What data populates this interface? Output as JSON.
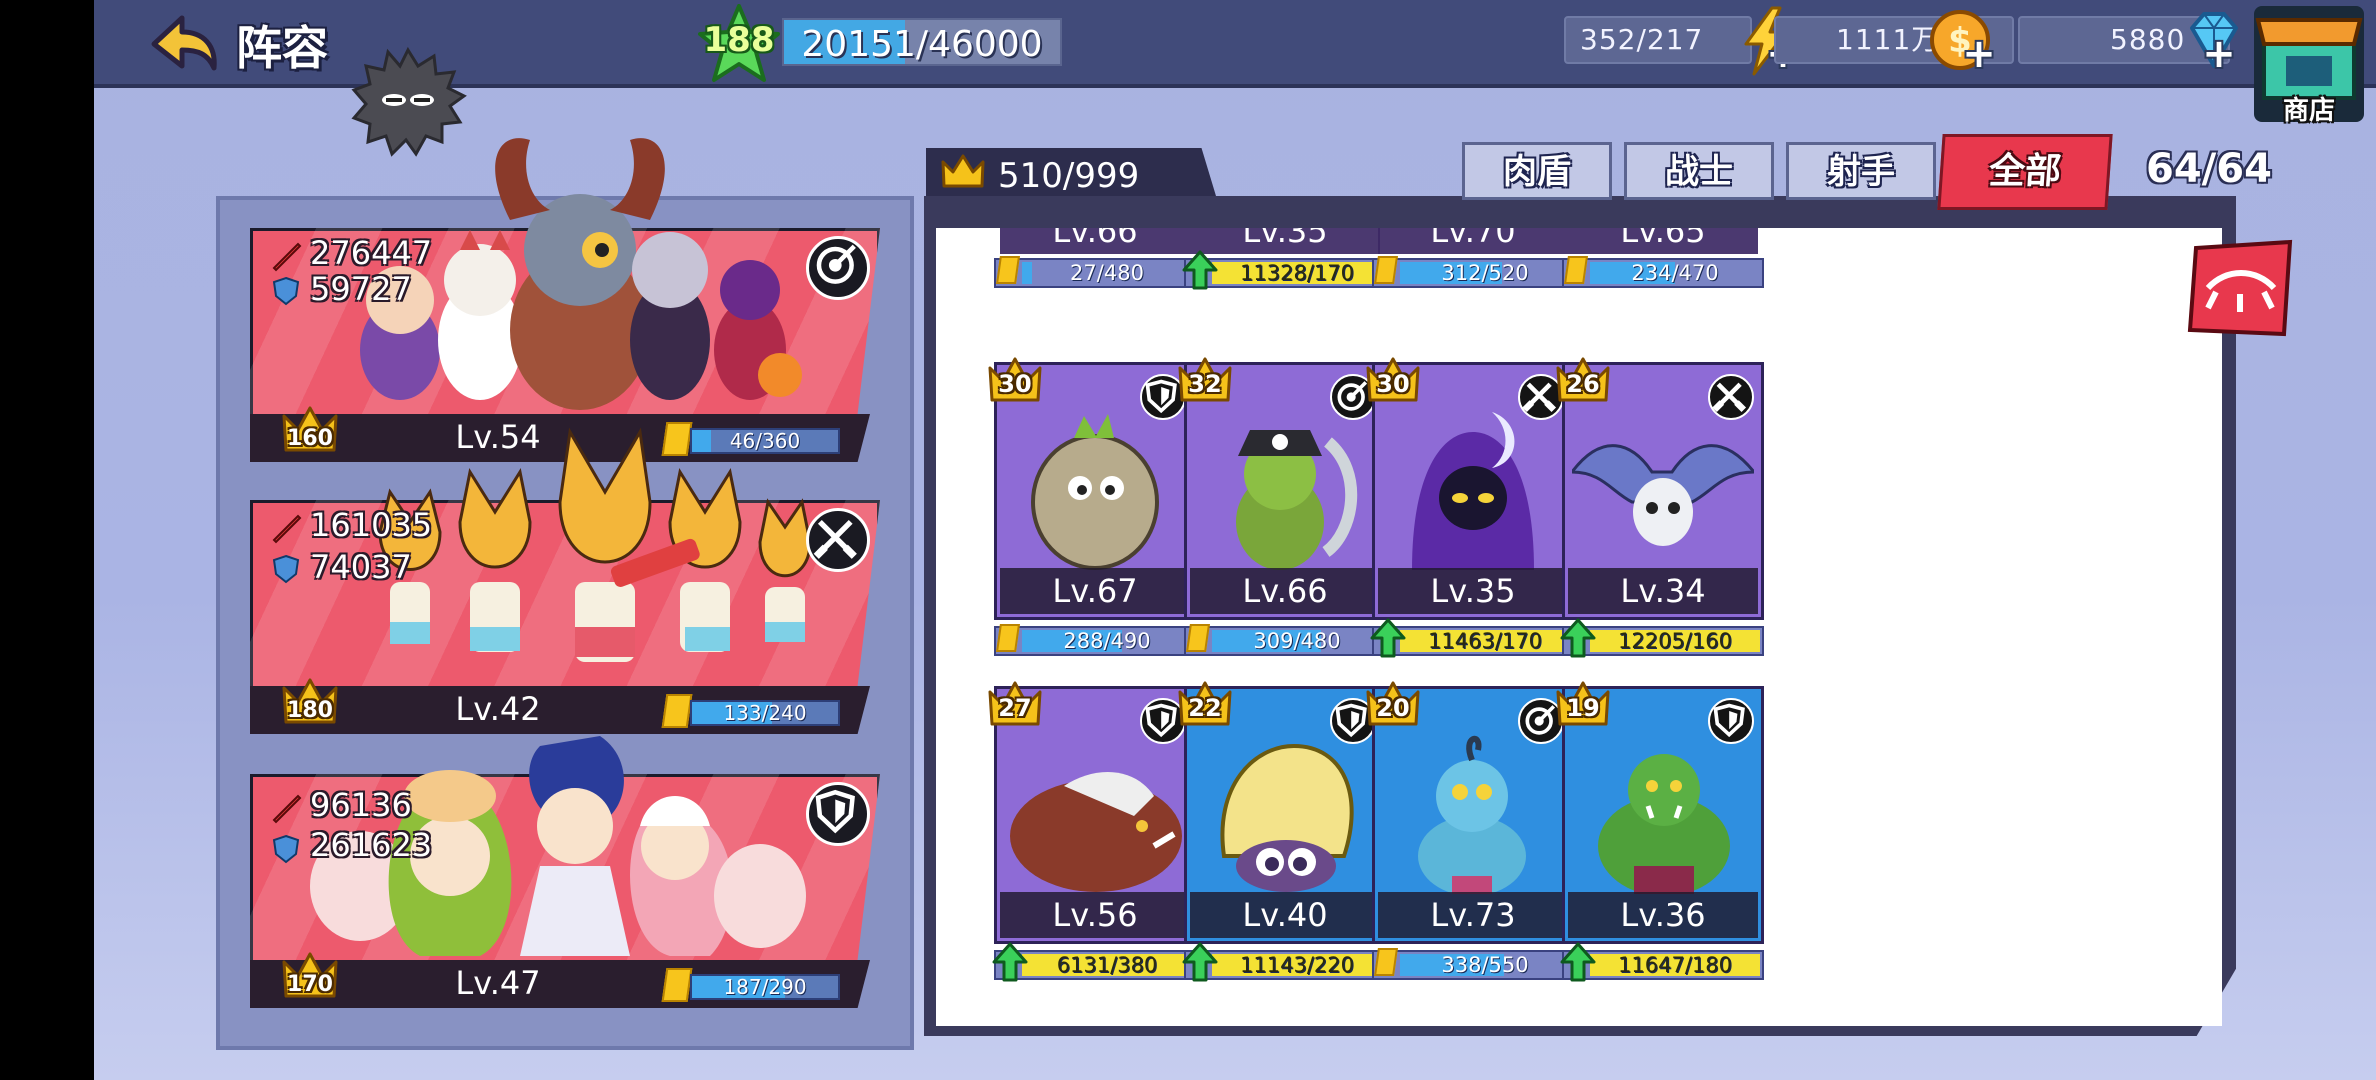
{
  "header": {
    "title": "阵容",
    "player_level": "188",
    "exp_text": "20151/46000",
    "exp_fraction": 0.438,
    "stamina": "352/217",
    "gold": "1111万",
    "gems": "5880",
    "shop_label": "商店"
  },
  "teams": [
    {
      "attack": "276447",
      "defense": "59727",
      "crown": "160",
      "level": "Lv.54",
      "frag": "46/360",
      "frag_fraction": 0.13,
      "role": "archer-icon"
    },
    {
      "attack": "161035",
      "defense": "74037",
      "crown": "180",
      "level": "Lv.42",
      "frag": "133/240",
      "frag_fraction": 0.55,
      "role": "warrior-icon"
    },
    {
      "attack": "96136",
      "defense": "261623",
      "crown": "170",
      "level": "Lv.47",
      "frag": "187/290",
      "frag_fraction": 0.64,
      "role": "shield-icon"
    }
  ],
  "collection": {
    "count": "510/999",
    "filters": [
      "肉盾",
      "战士",
      "射手",
      "全部"
    ],
    "active_filter": "全部",
    "total": "64/64"
  },
  "partial_row": [
    {
      "level": "Lv.66",
      "frag": "27/480",
      "upgrade": false,
      "frag_fraction": 0.06
    },
    {
      "level": "Lv.35",
      "frag": "11328/170",
      "upgrade": true,
      "frag_fraction": 1
    },
    {
      "level": "Lv.70",
      "frag": "312/520",
      "upgrade": false,
      "frag_fraction": 0.6
    },
    {
      "level": "Lv.65",
      "frag": "234/470",
      "upgrade": false,
      "frag_fraction": 0.5
    }
  ],
  "cards": [
    {
      "crown": "30",
      "level": "Lv.67",
      "frag": "288/490",
      "upgrade": false,
      "frag_fraction": 0.59,
      "role": "shield-icon",
      "rarity": "purple",
      "art": "rock-golem"
    },
    {
      "crown": "32",
      "level": "Lv.66",
      "frag": "309/480",
      "upgrade": false,
      "frag_fraction": 0.64,
      "role": "archer-icon",
      "rarity": "purple",
      "art": "goblin-pirate"
    },
    {
      "crown": "30",
      "level": "Lv.35",
      "frag": "11463/170",
      "upgrade": true,
      "frag_fraction": 1,
      "role": "warrior-icon",
      "rarity": "purple",
      "art": "hooded-mage"
    },
    {
      "crown": "26",
      "level": "Lv.34",
      "frag": "12205/160",
      "upgrade": true,
      "frag_fraction": 1,
      "role": "warrior-icon",
      "rarity": "purple",
      "art": "skull-bat"
    },
    {
      "crown": "27",
      "level": "Lv.56",
      "frag": "6131/380",
      "upgrade": true,
      "frag_fraction": 1,
      "role": "shield-icon",
      "rarity": "purple",
      "art": "boar-beast"
    },
    {
      "crown": "22",
      "level": "Lv.40",
      "frag": "11143/220",
      "upgrade": true,
      "frag_fraction": 1,
      "role": "shield-icon",
      "rarity": "blue",
      "art": "hermit-snail"
    },
    {
      "crown": "20",
      "level": "Lv.73",
      "frag": "338/550",
      "upgrade": false,
      "frag_fraction": 0.61,
      "role": "archer-icon",
      "rarity": "blue",
      "art": "blue-troll"
    },
    {
      "crown": "19",
      "level": "Lv.36",
      "frag": "11647/180",
      "upgrade": true,
      "frag_fraction": 1,
      "role": "shield-icon",
      "rarity": "blue",
      "art": "green-orc"
    }
  ],
  "colors": {
    "purple_card": "#8e6bd6",
    "blue_card": "#2f8fe0",
    "team_bg": "#ed5a6d",
    "active_tab": "#e8384d",
    "upgrade_bar": "#f4e234",
    "frag_bar": "#41a9ec"
  }
}
